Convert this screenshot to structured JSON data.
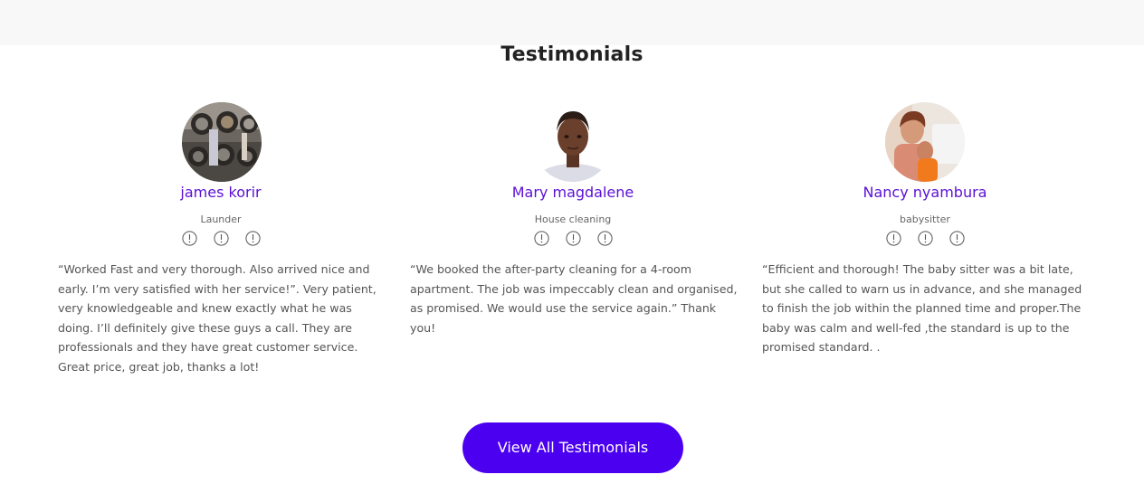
{
  "section": {
    "title": "Testimonials"
  },
  "colors": {
    "accent": "#4b00f0",
    "name_color": "#5b0fd6",
    "top_bar": "#f8f8f8"
  },
  "testimonials": [
    {
      "name": "james korir",
      "role": "Launder",
      "rating_icons": [
        "exclamation-circle-icon",
        "exclamation-circle-icon",
        "exclamation-circle-icon"
      ],
      "quote": "“Worked Fast and very thorough. Also arrived nice and early. I’m very satisfied with her service!”. Very patient, very knowledgeable and knew exactly what he was doing. I’ll definitely give these guys a call. They are professionals and they have great customer service. Great price, great job, thanks a lot!"
    },
    {
      "name": "Mary magdalene",
      "role": "House cleaning",
      "rating_icons": [
        "exclamation-circle-icon",
        "exclamation-circle-icon",
        "exclamation-circle-icon"
      ],
      "quote": "“We booked the after-party cleaning for a 4-room apartment. The job was impeccably clean and organised, as promised. We would use the service again.” Thank you!"
    },
    {
      "name": "Nancy nyambura",
      "role": "babysitter",
      "rating_icons": [
        "exclamation-circle-icon",
        "exclamation-circle-icon",
        "exclamation-circle-icon"
      ],
      "quote": "“Efficient and thorough! The baby sitter was a bit late, but she called to warn us in advance, and she managed to finish the job within the planned time and proper.The baby was calm and well-fed ,the standard is up to the promised standard. ."
    }
  ],
  "cta": {
    "label": "View All Testimonials"
  }
}
